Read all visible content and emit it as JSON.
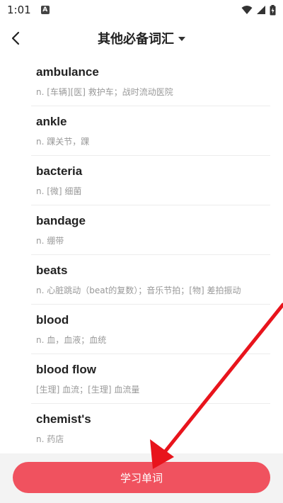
{
  "status_bar": {
    "time": "1:01",
    "app_icon_letter": "A"
  },
  "header": {
    "title": "其他必备词汇"
  },
  "words": [
    {
      "word": "ambulance",
      "meaning": "n. [车辆][医] 救护车；战时流动医院"
    },
    {
      "word": "ankle",
      "meaning": "n. 踝关节，踝"
    },
    {
      "word": "bacteria",
      "meaning": "n. [微] 细菌"
    },
    {
      "word": "bandage",
      "meaning": "n. 绷带"
    },
    {
      "word": "beats",
      "meaning": "n. 心脏跳动（beat的复数）；音乐节拍；[物] 差拍振动"
    },
    {
      "word": "blood",
      "meaning": "n. 血，血液；血统"
    },
    {
      "word": "blood flow",
      "meaning": "[生理] 血流；[生理] 血流量"
    },
    {
      "word": "chemist's",
      "meaning": "n. 药店"
    }
  ],
  "bottom": {
    "study_button_label": "学习单词"
  },
  "colors": {
    "accent": "#f0525f",
    "annotation_arrow": "#e8141c"
  }
}
